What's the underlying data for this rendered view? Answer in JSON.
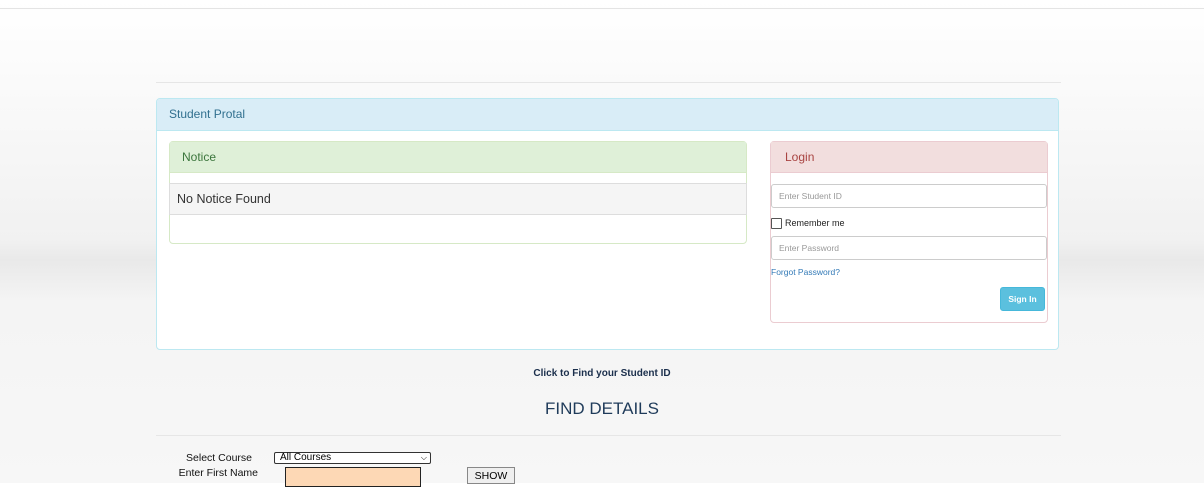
{
  "portal": {
    "title": "Student Protal"
  },
  "notice": {
    "title": "Notice",
    "items": [
      "No Notice Found"
    ]
  },
  "login": {
    "title": "Login",
    "student_id_placeholder": "Enter Student ID",
    "remember_label": "Remember me",
    "password_placeholder": "Enter Password",
    "forgot_label": "Forgot Password?",
    "signin_label": "Sign In"
  },
  "find": {
    "link_label": "Click to Find your Student ID",
    "title": "FIND DETAILS",
    "select_course_label": "Select Course",
    "selected_course": "All Courses",
    "first_name_label": "Enter First Name",
    "show_label": "SHOW"
  },
  "colors": {
    "portal_heading_bg": "#d9edf7",
    "notice_heading_bg": "#dff0d8",
    "login_heading_bg": "#f2dede",
    "signin_button_bg": "#5bc0de",
    "name_input_bg": "#fdd8b5"
  }
}
